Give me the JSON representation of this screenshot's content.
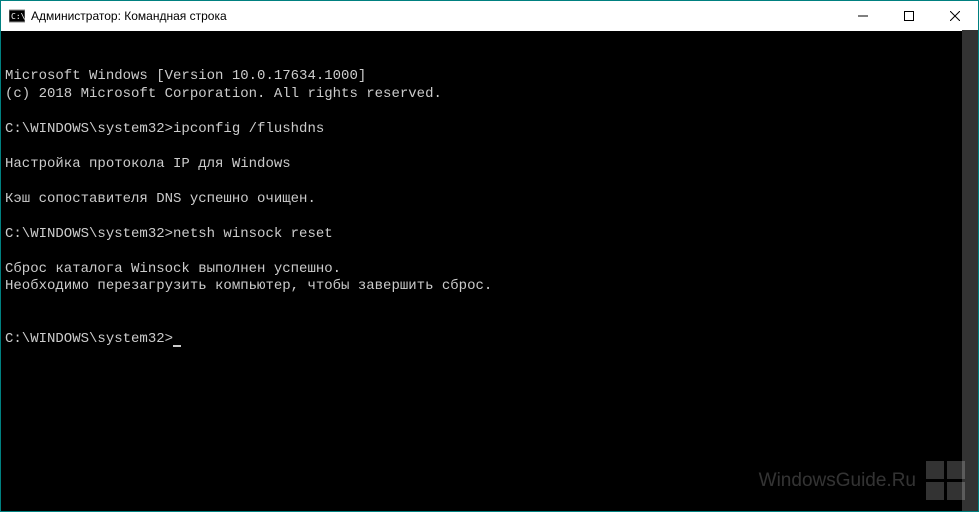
{
  "window": {
    "title": "Администратор: Командная строка"
  },
  "terminal": {
    "lines": [
      "Microsoft Windows [Version 10.0.17634.1000]",
      "(c) 2018 Microsoft Corporation. All rights reserved.",
      "",
      "C:\\WINDOWS\\system32>ipconfig /flushdns",
      "",
      "Настройка протокола IP для Windows",
      "",
      "Кэш сопоставителя DNS успешно очищен.",
      "",
      "C:\\WINDOWS\\system32>netsh winsock reset",
      "",
      "Сброс каталога Winsock выполнен успешно.",
      "Необходимо перезагрузить компьютер, чтобы завершить сброс.",
      "",
      "",
      "C:\\WINDOWS\\system32>"
    ],
    "prompt": "C:\\WINDOWS\\system32>"
  },
  "watermark": {
    "text": "WindowsGuide.Ru"
  }
}
